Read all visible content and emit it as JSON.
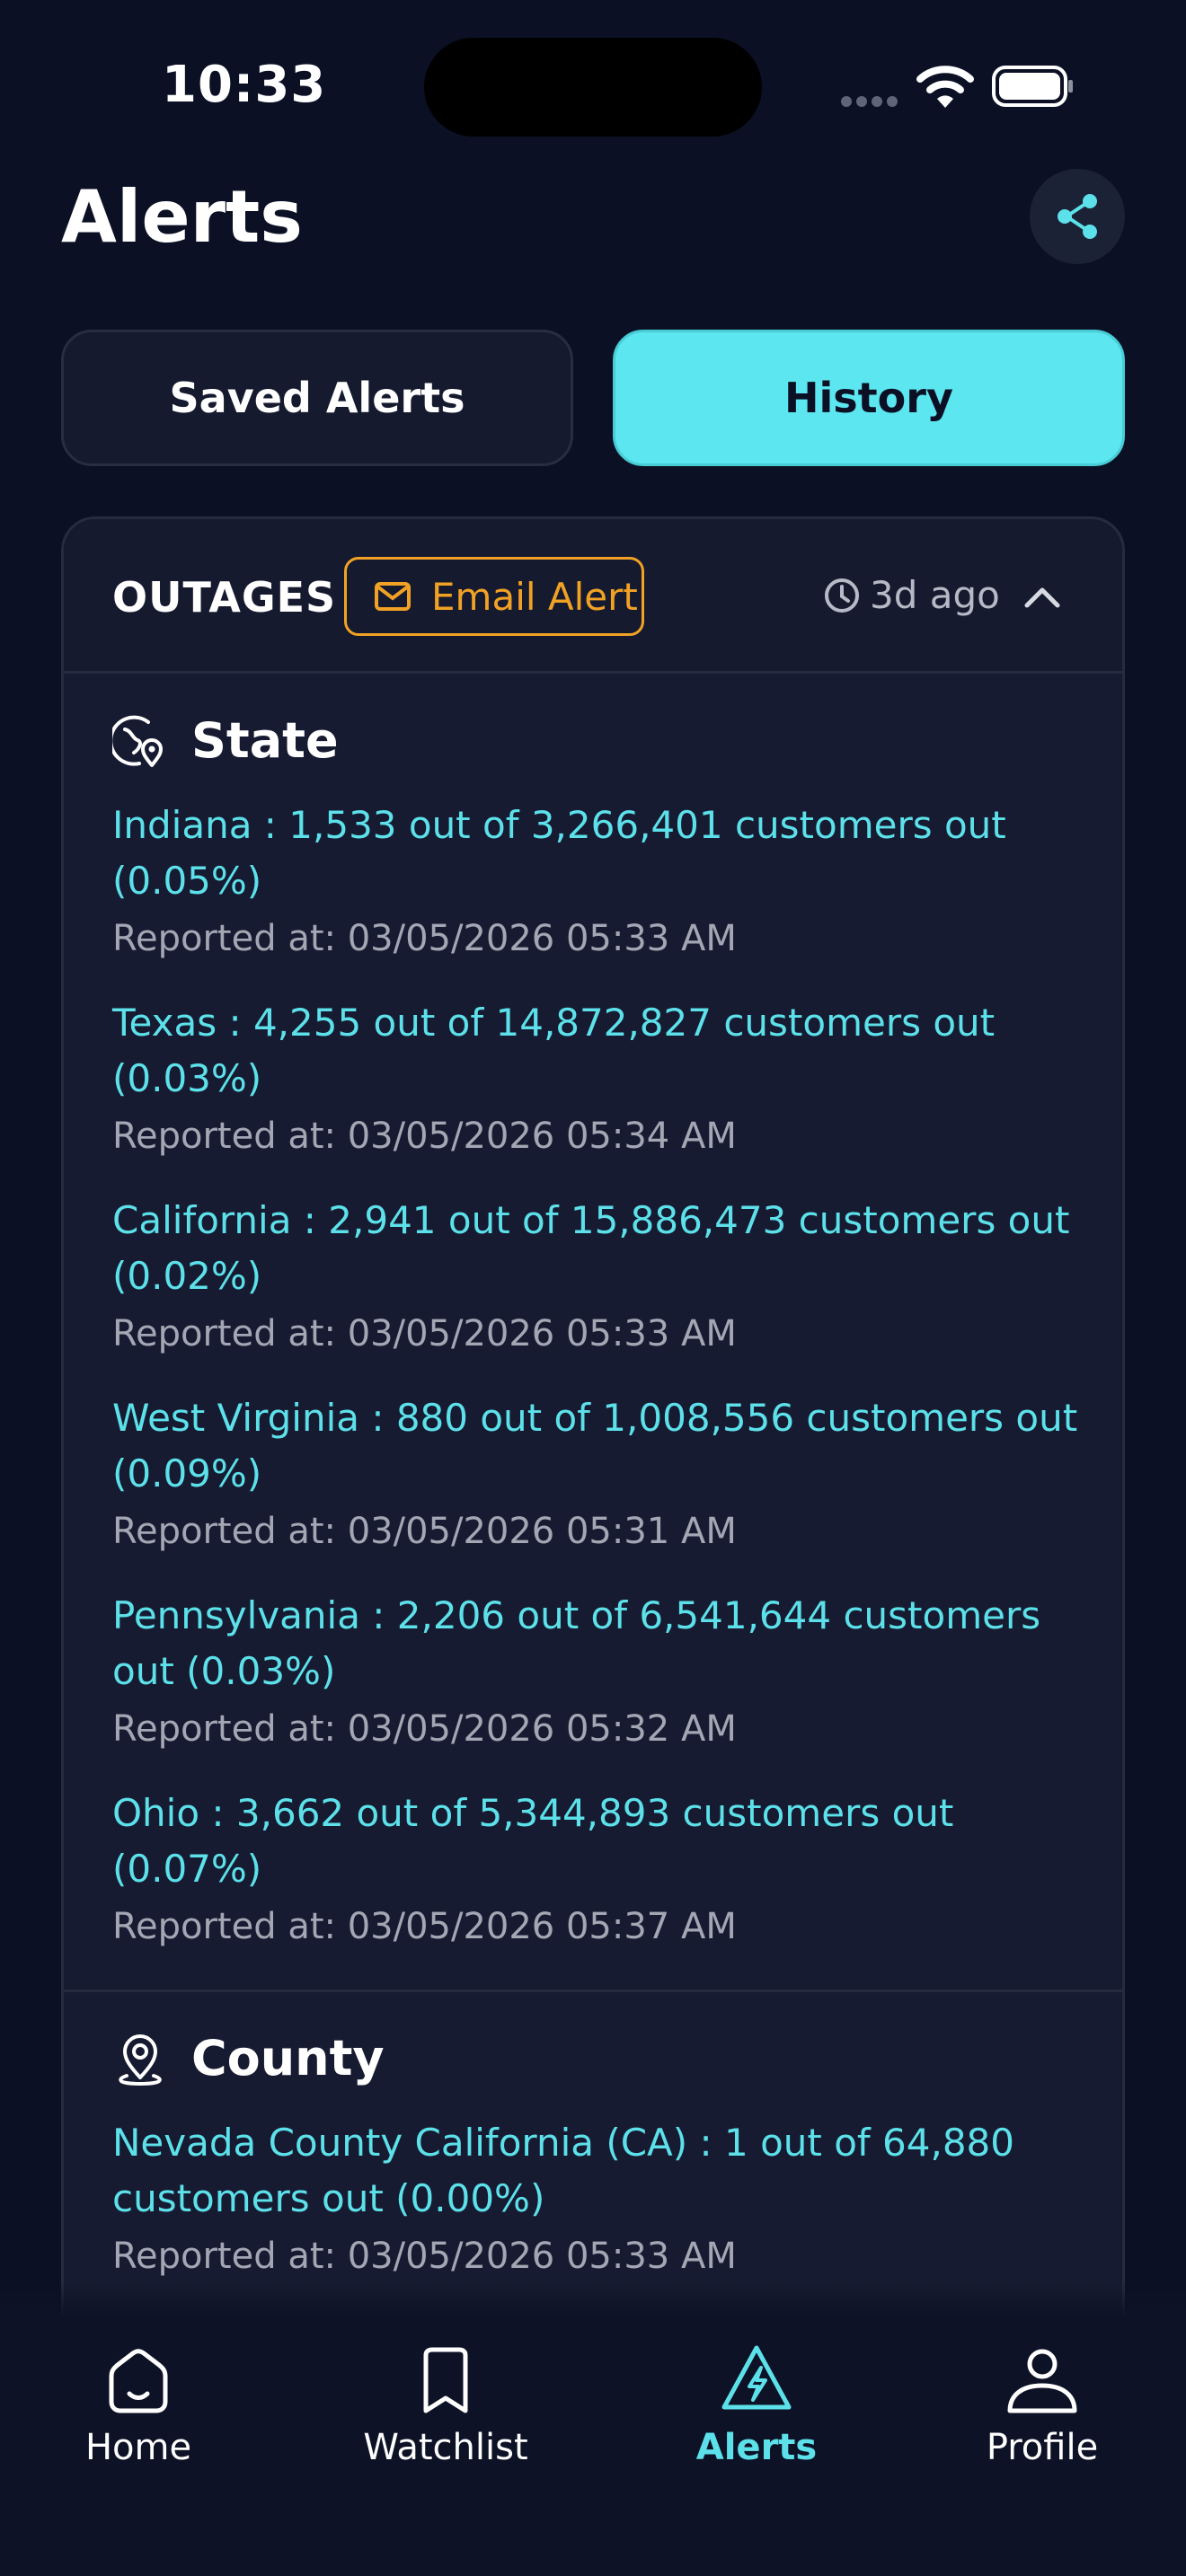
{
  "status_bar": {
    "time": "10:33"
  },
  "header": {
    "title": "Alerts",
    "share_icon": "share-icon"
  },
  "tabs": [
    {
      "label": "Saved Alerts",
      "active": false
    },
    {
      "label": "History",
      "active": true
    }
  ],
  "alert_card": {
    "category": "OUTAGES",
    "badge": "Email Alert",
    "time_ago": "3d ago",
    "expanded": true,
    "accent_color": "#5ce1ea",
    "badge_color": "#f1a225",
    "sections": [
      {
        "label": "State",
        "icon": "globe-pin-icon",
        "entries": [
          {
            "summary": "Indiana : 1,533 out of 3,266,401 customers out (0.05%)",
            "reported": "Reported at: 03/05/2026 05:33 AM"
          },
          {
            "summary": "Texas : 4,255 out of 14,872,827 customers out (0.03%)",
            "reported": "Reported at: 03/05/2026 05:34 AM"
          },
          {
            "summary": "California : 2,941 out of 15,886,473 customers out (0.02%)",
            "reported": "Reported at: 03/05/2026 05:33 AM"
          },
          {
            "summary": "West Virginia : 880 out of 1,008,556 customers out (0.09%)",
            "reported": "Reported at: 03/05/2026 05:31 AM"
          },
          {
            "summary": "Pennsylvania : 2,206 out of 6,541,644 customers out (0.03%)",
            "reported": "Reported at: 03/05/2026 05:32 AM"
          },
          {
            "summary": "Ohio : 3,662 out of 5,344,893 customers out (0.07%)",
            "reported": "Reported at: 03/05/2026 05:37 AM"
          }
        ]
      },
      {
        "label": "County",
        "icon": "map-pin-icon",
        "entries": [
          {
            "summary": "Nevada County California (CA) : 1 out of 64,880 customers out (0.00%)",
            "reported": "Reported at: 03/05/2026 05:33 AM"
          }
        ]
      }
    ]
  },
  "bottom_nav": [
    {
      "label": "Home",
      "icon": "home-icon",
      "active": false
    },
    {
      "label": "Watchlist",
      "icon": "bookmark-icon",
      "active": false
    },
    {
      "label": "Alerts",
      "icon": "alert-bolt-icon",
      "active": true
    },
    {
      "label": "Profile",
      "icon": "profile-icon",
      "active": false
    }
  ]
}
